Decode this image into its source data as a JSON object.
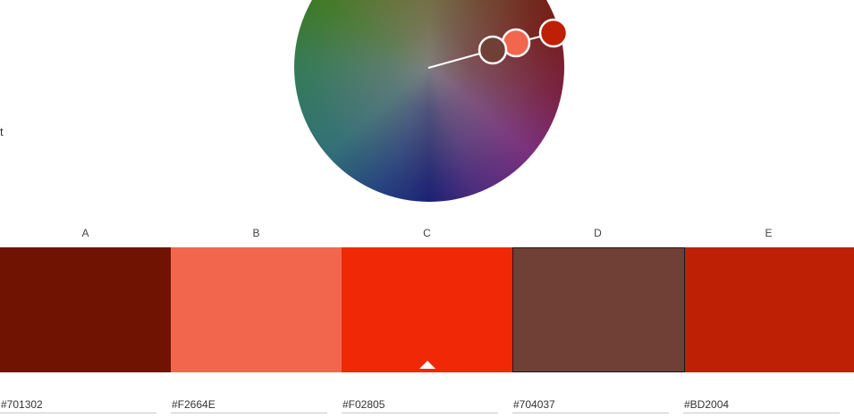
{
  "side_fragment": "t",
  "wheel": {
    "handles": [
      {
        "name": "handle-e",
        "color": "#BD2004",
        "active": true
      },
      {
        "name": "handle-b",
        "color": "#F2664E",
        "active": false
      },
      {
        "name": "handle-d",
        "color": "#704037",
        "active": false
      }
    ]
  },
  "palette": {
    "selected_index": 2,
    "framed_index": 3,
    "swatches": [
      {
        "label": "A",
        "hex": "#701302"
      },
      {
        "label": "B",
        "hex": "#F2664E"
      },
      {
        "label": "C",
        "hex": "#F02805"
      },
      {
        "label": "D",
        "hex": "#704037"
      },
      {
        "label": "E",
        "hex": "#BD2004"
      }
    ]
  }
}
